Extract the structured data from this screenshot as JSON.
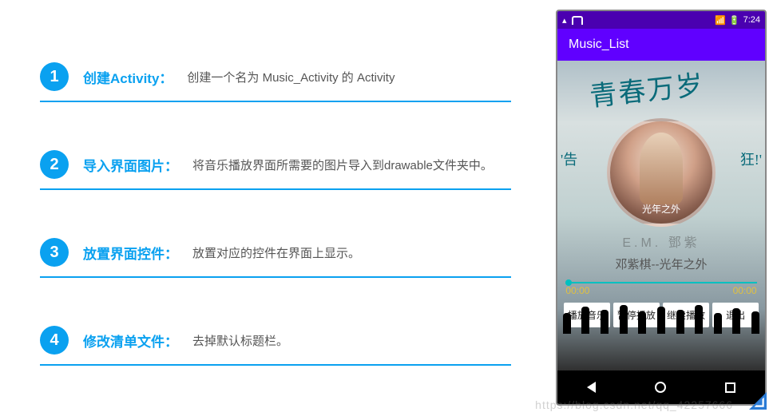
{
  "steps": [
    {
      "num": "1",
      "title": "创建Activity：",
      "desc": "创建一个名为 Music_Activity 的 Activity"
    },
    {
      "num": "2",
      "title": "导入界面图片：",
      "desc": "将音乐播放界面所需要的图片导入到drawable文件夹中。"
    },
    {
      "num": "3",
      "title": "放置界面控件：",
      "desc": "放置对应的控件在界面上显示。"
    },
    {
      "num": "4",
      "title": "修改清单文件：",
      "desc": "去掉默认标题栏。"
    }
  ],
  "phone": {
    "status_time": "7:24",
    "appbar_title": "Music_List",
    "scribble": "青春万岁",
    "side_l": "'告",
    "side_r": "狂!'",
    "album_text": "光年之外",
    "artist_faded": "E.M. 鄧紫",
    "song_title": "邓紫棋--光年之外",
    "time_start": "00:00",
    "time_end": "00:00",
    "buttons": {
      "play": "播放音乐",
      "pause": "暂停播放",
      "resume": "继续播放",
      "exit": "退出"
    }
  },
  "watermark": "https://blog.csdn.net/qq_42257666"
}
